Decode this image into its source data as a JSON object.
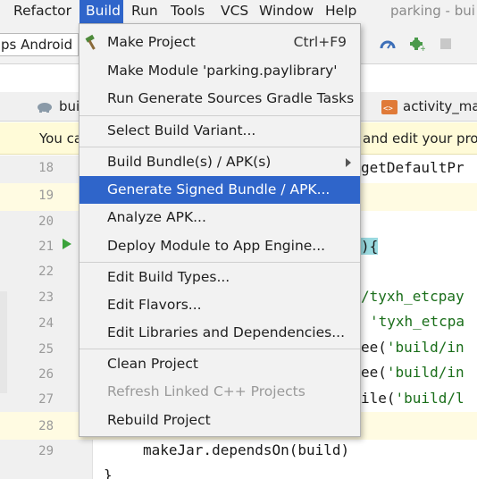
{
  "menubar": {
    "items": [
      "Refactor",
      "Build",
      "Run",
      "Tools",
      "VCS",
      "Window",
      "Help"
    ],
    "active": "Build",
    "title": "parking - bui"
  },
  "toolbar": {
    "run_config": "ps Android H",
    "icons": [
      "profiler-icon",
      "apply-changes-icon",
      "stop-icon"
    ]
  },
  "tabs": {
    "left_tab": "bui",
    "right_tab": "activity_ma"
  },
  "notification": {
    "left_text": "You ca",
    "right_text": "and edit your pro"
  },
  "editor": {
    "line_numbers": [
      "18",
      "19",
      "20",
      "21",
      "22",
      "23",
      "24",
      "25",
      "26",
      "27",
      "28",
      "29"
    ],
    "code": {
      "l18": "getDefaultPr",
      "l21": "){",
      "l23": "/tyxh_etcpay",
      "l24": "'tyxh_etcpa",
      "l25_a": "ee(",
      "l25_b": "'build/in",
      "l26_a": "ee(",
      "l26_b": "'build/in",
      "l27_a": "ile(",
      "l27_b": "'build/l",
      "l29": "makeJar.dependsOn(build)",
      "l30": "}"
    }
  },
  "build_menu": {
    "items": [
      {
        "label": "Make Project",
        "shortcut": "Ctrl+F9",
        "icon": "hammer-icon"
      },
      {
        "label": "Make Module 'parking.paylibrary'"
      },
      {
        "label": "Run Generate Sources Gradle Tasks"
      },
      {
        "label": "Select Build Variant..."
      },
      {
        "label": "Build Bundle(s) / APK(s)",
        "submenu": true
      },
      {
        "label": "Generate Signed Bundle / APK...",
        "selected": true
      },
      {
        "label": "Analyze APK..."
      },
      {
        "label": "Deploy Module to App Engine..."
      },
      {
        "label": "Edit Build Types..."
      },
      {
        "label": "Edit Flavors..."
      },
      {
        "label": "Edit Libraries and Dependencies..."
      },
      {
        "label": "Clean Project"
      },
      {
        "label": "Refresh Linked C++ Projects",
        "disabled": true
      },
      {
        "label": "Rebuild Project"
      }
    ]
  },
  "colors": {
    "accent": "#2f65ca",
    "menu_bg": "#f2f2f2",
    "string": "#1a6e1a"
  }
}
